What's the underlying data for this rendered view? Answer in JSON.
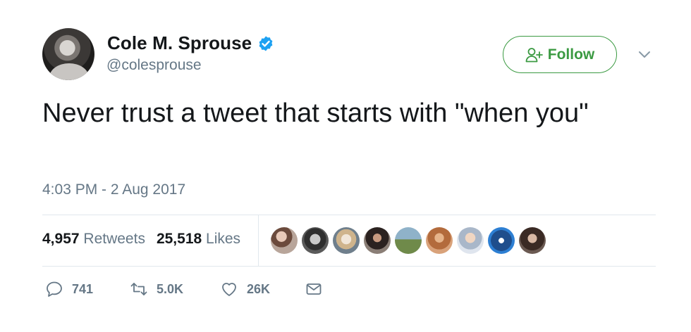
{
  "user": {
    "name": "Cole M. Sprouse",
    "handle": "@colesprouse",
    "avatar_icon": "profile-photo",
    "verified_color": "#1da1f2"
  },
  "header": {
    "follow_label": "Follow",
    "follow_icon": "add-user-icon",
    "accent_color": "#3b9a42",
    "more_icon": "chevron-down-icon"
  },
  "tweet": {
    "text": "Never trust a tweet that starts with \"when you\"",
    "timestamp": "4:03 PM - 2 Aug 2017"
  },
  "stats": {
    "retweets_count": "4,957",
    "retweets_label": "Retweets",
    "likes_count": "25,518",
    "likes_label": "Likes"
  },
  "likers": [
    "liker-avatar-1",
    "liker-avatar-2",
    "liker-avatar-3",
    "liker-avatar-4",
    "liker-avatar-5",
    "liker-avatar-6",
    "liker-avatar-7",
    "liker-avatar-8",
    "liker-avatar-9"
  ],
  "actions": {
    "reply_count": "741",
    "retweet_count": "5.0K",
    "like_count": "26K",
    "reply_icon": "reply-icon",
    "retweet_icon": "retweet-icon",
    "like_icon": "heart-icon",
    "dm_icon": "envelope-icon"
  }
}
